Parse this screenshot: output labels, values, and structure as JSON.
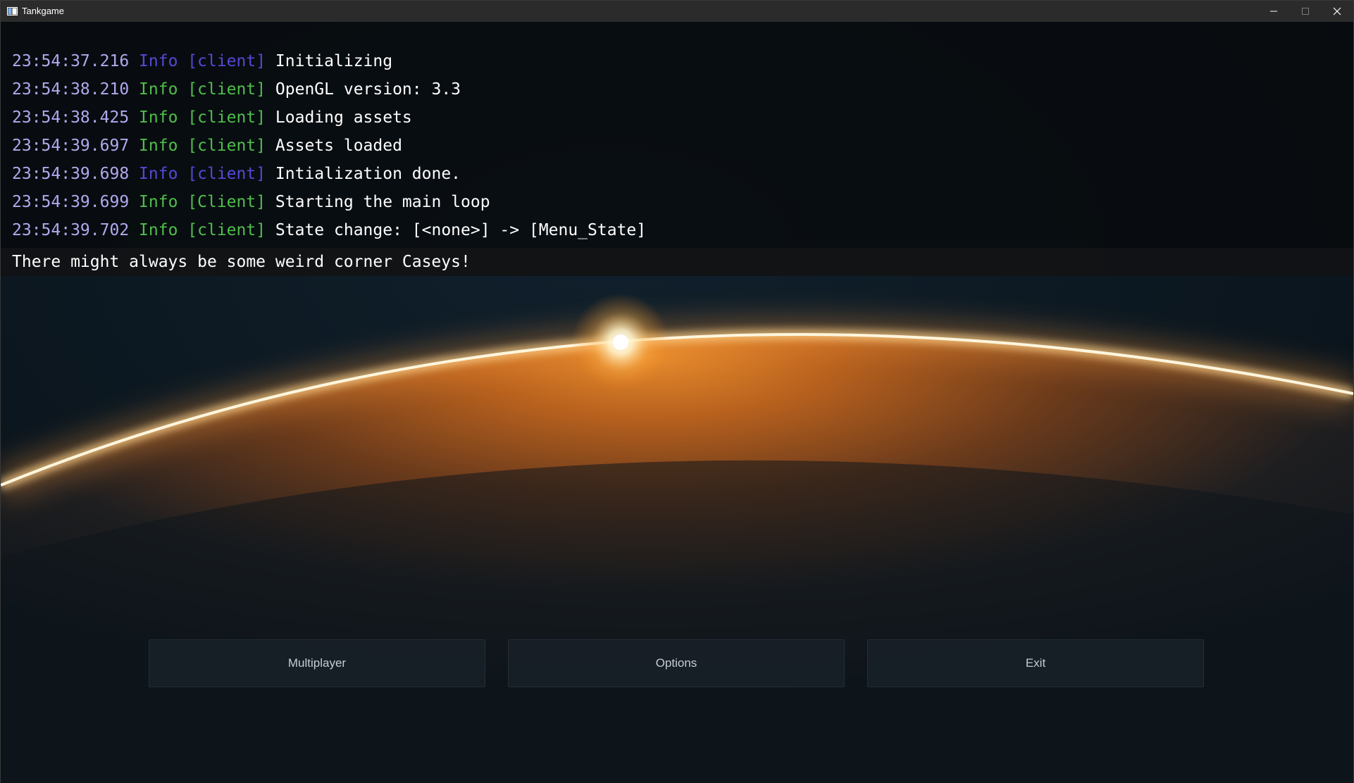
{
  "window": {
    "title": "Tankgame",
    "controls": {
      "minimize": "minimize-icon",
      "maximize": "maximize-icon",
      "close": "close-icon"
    }
  },
  "console": {
    "lines": [
      {
        "time": "23:54:37.216",
        "level": "Info",
        "tag": "[client]",
        "message": "Initializing",
        "tag_color": "#5549d6"
      },
      {
        "time": "23:54:38.210",
        "level": "Info",
        "tag": "[client]",
        "message": "OpenGL version: 3.3",
        "tag_color": "#4fbf4a"
      },
      {
        "time": "23:54:38.425",
        "level": "Info",
        "tag": "[client]",
        "message": "Loading assets",
        "tag_color": "#4fbf4a"
      },
      {
        "time": "23:54:39.697",
        "level": "Info",
        "tag": "[client]",
        "message": "Assets loaded",
        "tag_color": "#4fbf4a"
      },
      {
        "time": "23:54:39.698",
        "level": "Info",
        "tag": "[client]",
        "message": "Intialization done.",
        "tag_color": "#5549d6"
      },
      {
        "time": "23:54:39.699",
        "level": "Info",
        "tag": "[Client]",
        "message": "Starting the main loop",
        "tag_color": "#4fbf4a"
      },
      {
        "time": "23:54:39.702",
        "level": "Info",
        "tag": "[client]",
        "message": "State change: [<none>] -> [Menu_State]",
        "tag_color": "#4fbf4a"
      }
    ],
    "input": "There might always be some weird corner Caseys!"
  },
  "menu": {
    "multiplayer_label": "Multiplayer",
    "options_label": "Options",
    "exit_label": "Exit"
  },
  "colors": {
    "timestamp": "#b3a8ee",
    "level_blue": "#5549d6",
    "level_green": "#4fbf4a",
    "titlebar": "#2b2b2b",
    "horizon_glow": "#ffe6b0",
    "planet_surface": "#b8611e"
  }
}
